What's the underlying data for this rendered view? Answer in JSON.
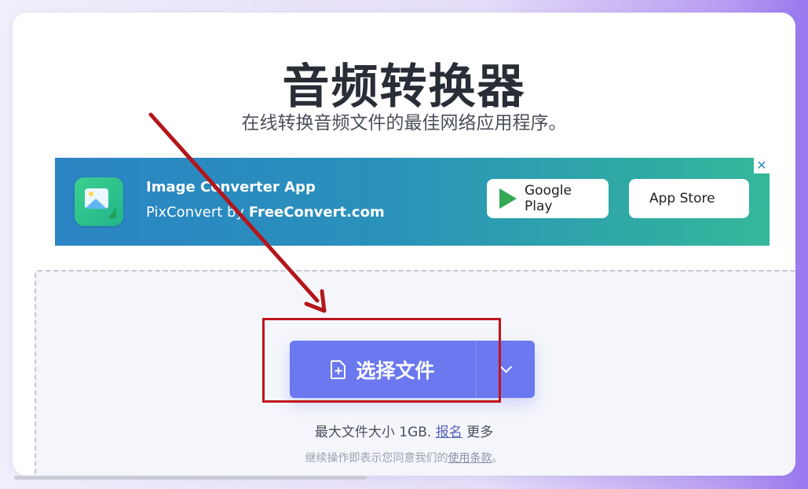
{
  "header": {
    "title": "音频转换器",
    "subtitle": "在线转换音频文件的最佳网络应用程序。"
  },
  "banner": {
    "app_name": "Image Converter App",
    "by_prefix": "PixConvert by ",
    "by_brand": "FreeConvert.com",
    "close_label": "✕",
    "google_play_label": "Google Play",
    "app_store_label": "App Store"
  },
  "upload": {
    "choose_label": "选择文件",
    "max_size_text": "最大文件大小 1GB.",
    "signup_link": "报名",
    "more_text": "更多",
    "terms_prefix": "继续操作即表示您同意我们的",
    "terms_link": "使用条款",
    "terms_suffix": "。"
  },
  "colors": {
    "primary": "#6b78ef",
    "annotation": "#c0141b",
    "banner_start": "#2b84c4",
    "banner_end": "#35b79a"
  }
}
